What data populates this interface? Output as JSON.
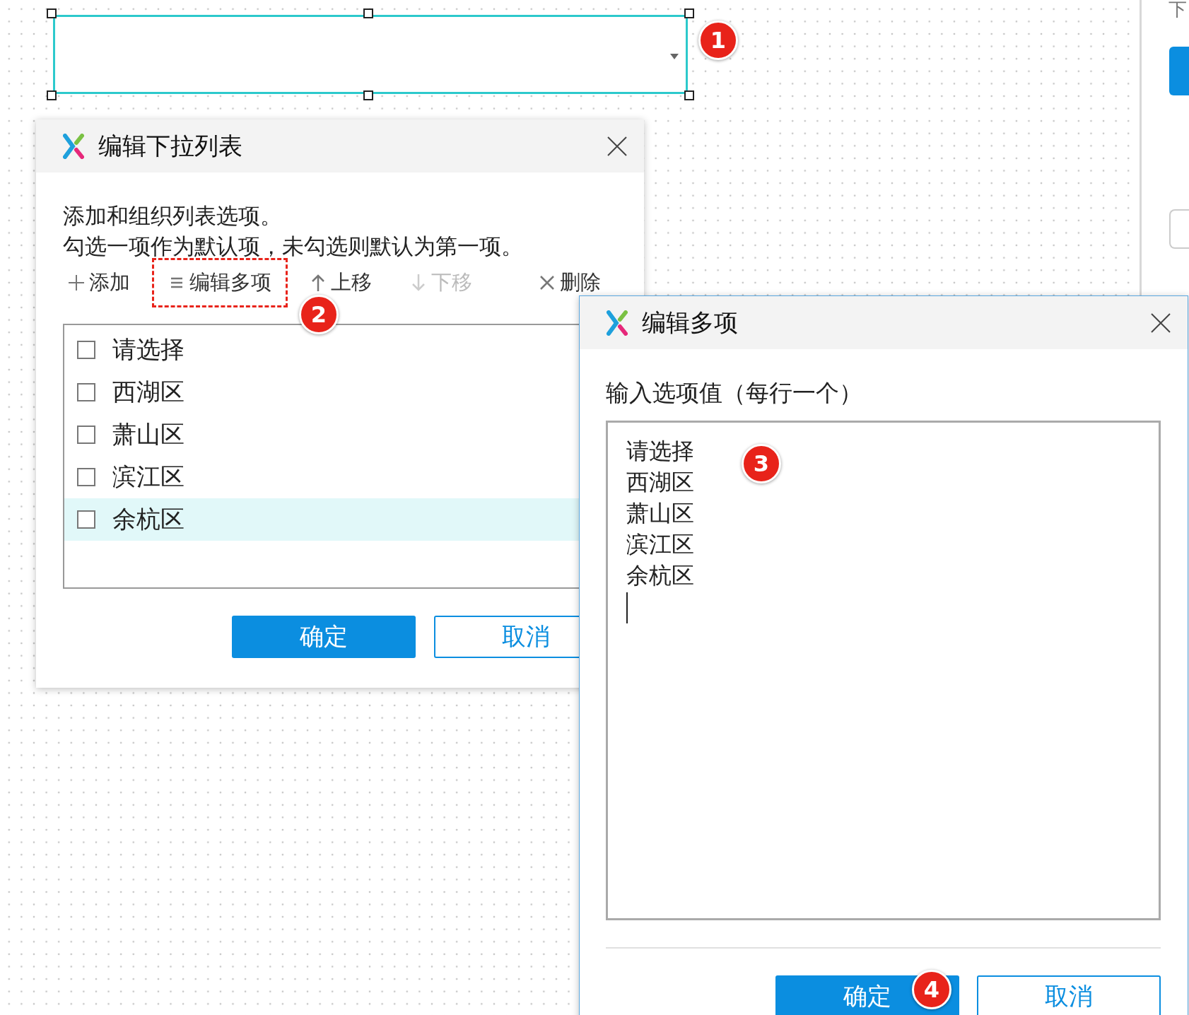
{
  "widget": {
    "selected": true
  },
  "callouts": [
    {
      "number": "1"
    },
    {
      "number": "2"
    },
    {
      "number": "3"
    },
    {
      "number": "4"
    }
  ],
  "list_dialog": {
    "title": "编辑下拉列表",
    "description": [
      "添加和组织列表选项。",
      "勾选一项作为默认项，未勾选则默认为第一项。"
    ],
    "toolbar": [
      {
        "kind": "add",
        "label": "添加",
        "disabled": false,
        "highlighted": false
      },
      {
        "kind": "edit",
        "label": "编辑多项",
        "disabled": false,
        "highlighted": true
      },
      {
        "kind": "up",
        "label": "上移",
        "disabled": false,
        "highlighted": false
      },
      {
        "kind": "down",
        "label": "下移",
        "disabled": true,
        "highlighted": false
      },
      {
        "kind": "delete",
        "label": "删除",
        "disabled": false,
        "highlighted": false
      }
    ],
    "options": [
      {
        "label": "请选择",
        "checked": false,
        "selected": false
      },
      {
        "label": "西湖区",
        "checked": false,
        "selected": false
      },
      {
        "label": "萧山区",
        "checked": false,
        "selected": false
      },
      {
        "label": "滨江区",
        "checked": false,
        "selected": false
      },
      {
        "label": "余杭区",
        "checked": false,
        "selected": true
      }
    ],
    "buttons": [
      {
        "kind": "primary",
        "label": "确定"
      },
      {
        "kind": "secondary",
        "label": "取消"
      }
    ]
  },
  "multi_dialog": {
    "title": "编辑多项",
    "label": "输入选项值（每行一个）",
    "lines": [
      "请选择",
      "西湖区",
      "萧山区",
      "滨江区",
      "余杭区"
    ],
    "buttons": [
      {
        "kind": "primary",
        "label": "确定"
      },
      {
        "kind": "secondary",
        "label": "取消"
      }
    ]
  },
  "side_panel": {
    "heading": "下"
  }
}
